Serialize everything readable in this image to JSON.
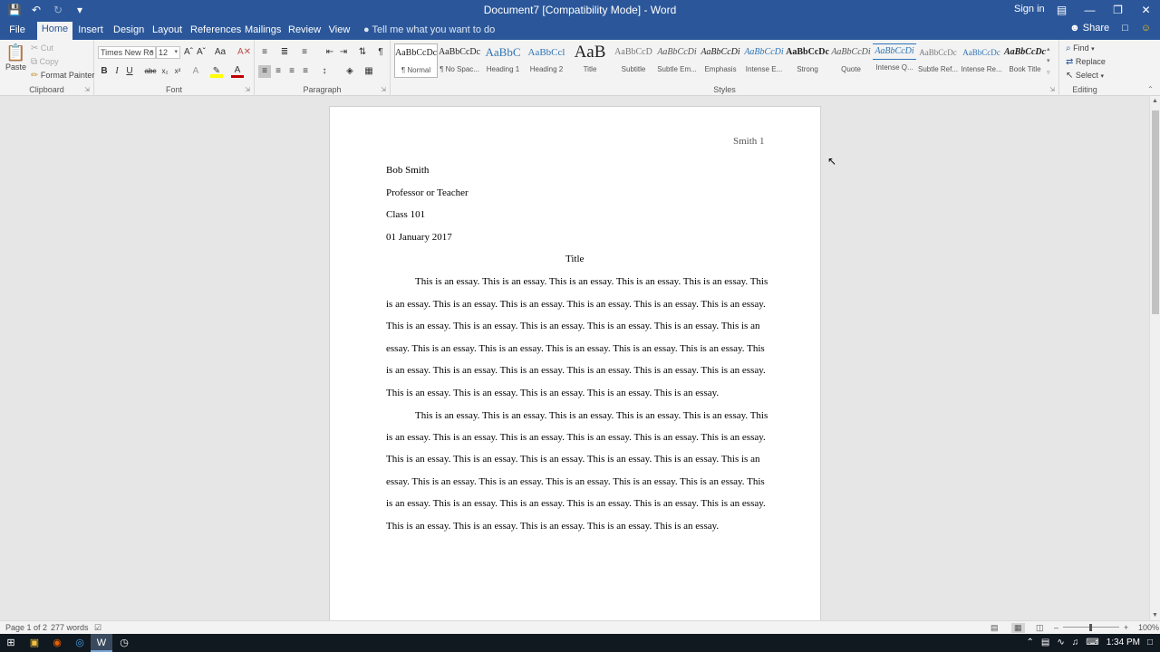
{
  "titlebar": {
    "doc_title": "Document7 [Compatibility Mode]  -  Word",
    "sign_in": "Sign in"
  },
  "tabs": [
    {
      "label": "File"
    },
    {
      "label": "Home"
    },
    {
      "label": "Insert"
    },
    {
      "label": "Design"
    },
    {
      "label": "Layout"
    },
    {
      "label": "References"
    },
    {
      "label": "Mailings"
    },
    {
      "label": "Review"
    },
    {
      "label": "View"
    }
  ],
  "active_tab": "Home",
  "tell_me": "Tell me what you want to do",
  "share_label": "Share",
  "clipboard": {
    "paste": "Paste",
    "cut": "Cut",
    "copy": "Copy",
    "format_painter": "Format Painter",
    "label": "Clipboard"
  },
  "font": {
    "family": "Times New Ro",
    "size": "12",
    "label": "Font"
  },
  "paragraph": {
    "label": "Paragraph"
  },
  "styles": {
    "label": "Styles",
    "items": [
      {
        "sample": "AaBbCcDc",
        "name": "¶ Normal"
      },
      {
        "sample": "AaBbCcDc",
        "name": "¶ No Spac..."
      },
      {
        "sample": "AaBbC",
        "name": "Heading 1"
      },
      {
        "sample": "AaBbCcl",
        "name": "Heading 2"
      },
      {
        "sample": "AaB",
        "name": "Title"
      },
      {
        "sample": "AaBbCcD",
        "name": "Subtitle"
      },
      {
        "sample": "AaBbCcDi",
        "name": "Subtle Em..."
      },
      {
        "sample": "AaBbCcDi",
        "name": "Emphasis"
      },
      {
        "sample": "AaBbCcDi",
        "name": "Intense E..."
      },
      {
        "sample": "AaBbCcDc",
        "name": "Strong"
      },
      {
        "sample": "AaBbCcDi",
        "name": "Quote"
      },
      {
        "sample": "AaBbCcDi",
        "name": "Intense Q..."
      },
      {
        "sample": "AaBbCcDc",
        "name": "Subtle Ref..."
      },
      {
        "sample": "AaBbCcDc",
        "name": "Intense Re..."
      },
      {
        "sample": "AaBbCcDc",
        "name": "Book Title"
      }
    ]
  },
  "editing": {
    "find": "Find",
    "replace": "Replace",
    "select": "Select",
    "label": "Editing"
  },
  "document": {
    "header": "Smith 1",
    "name": "Bob Smith",
    "teacher": "Professor or Teacher",
    "class": "Class 101",
    "date": "01 January 2017",
    "title": "Title",
    "para1": [
      "This is an essay. This is an essay. This is an essay. This is an essay. This is an essay. This",
      "is an essay. This is an essay. This is an essay. This is an essay. This is an essay. This is an essay.",
      "This is an essay. This is an essay. This is an essay. This is an essay. This is an essay. This is an",
      "essay. This is an essay. This is an essay. This is an essay. This is an essay. This is an essay. This",
      "is an essay. This is an essay. This is an essay. This is an essay. This is an essay. This is an essay.",
      "This is an essay. This is an essay. This is an essay. This is an essay. This is an essay."
    ],
    "para2": [
      "This is an essay. This is an essay. This is an essay. This is an essay. This is an essay. This",
      "is an essay. This is an essay. This is an essay. This is an essay. This is an essay. This is an essay.",
      "This is an essay. This is an essay. This is an essay. This is an essay. This is an essay. This is an",
      "essay. This is an essay. This is an essay. This is an essay. This is an essay. This is an essay. This",
      "is an essay. This is an essay. This is an essay. This is an essay. This is an essay. This is an essay.",
      "This is an essay. This is an essay. This is an essay. This is an essay. This is an essay."
    ]
  },
  "status": {
    "page": "Page 1 of 2",
    "words": "277 words",
    "zoom": "100%"
  },
  "taskbar": {
    "time": "1:34 PM"
  },
  "colors": {
    "brand": "#2b579a",
    "ribbon_bg": "#f3f3f3",
    "doc_bg": "#e6e6e6"
  }
}
